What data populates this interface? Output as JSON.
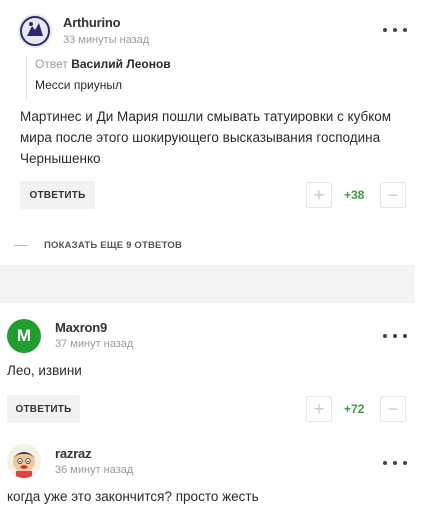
{
  "comments": [
    {
      "author": "Arthurino",
      "time": "33 минуты назад",
      "reply_prefix": "Ответ",
      "reply_to": "Василий Леонов",
      "quote": "Месси приуныл",
      "text": "Мартинес и Ди Мария пошли смывать татуировки с кубком мира после этого шокирующего высказывания господина Чернышенко",
      "reply_label": "ОТВЕТИТЬ",
      "plus": "+",
      "minus": "−",
      "score": "+38"
    },
    {
      "author": "Maxron9",
      "avatar_letter": "M",
      "avatar_color": "#1f9d2f",
      "time": "37 минут назад",
      "text": "Лео, извини",
      "reply_label": "ОТВЕТИТЬ",
      "plus": "+",
      "minus": "−",
      "score": "+72"
    },
    {
      "author": "razraz",
      "time": "36 минут назад",
      "text": "когда уже это закончится? просто жесть"
    }
  ],
  "show_more": "ПОКАЗАТЬ ЕЩЕ 9 ОТВЕТОВ",
  "colors": {
    "accent_green": "#3c9c3c",
    "avatar_green": "#1f9d2f"
  }
}
